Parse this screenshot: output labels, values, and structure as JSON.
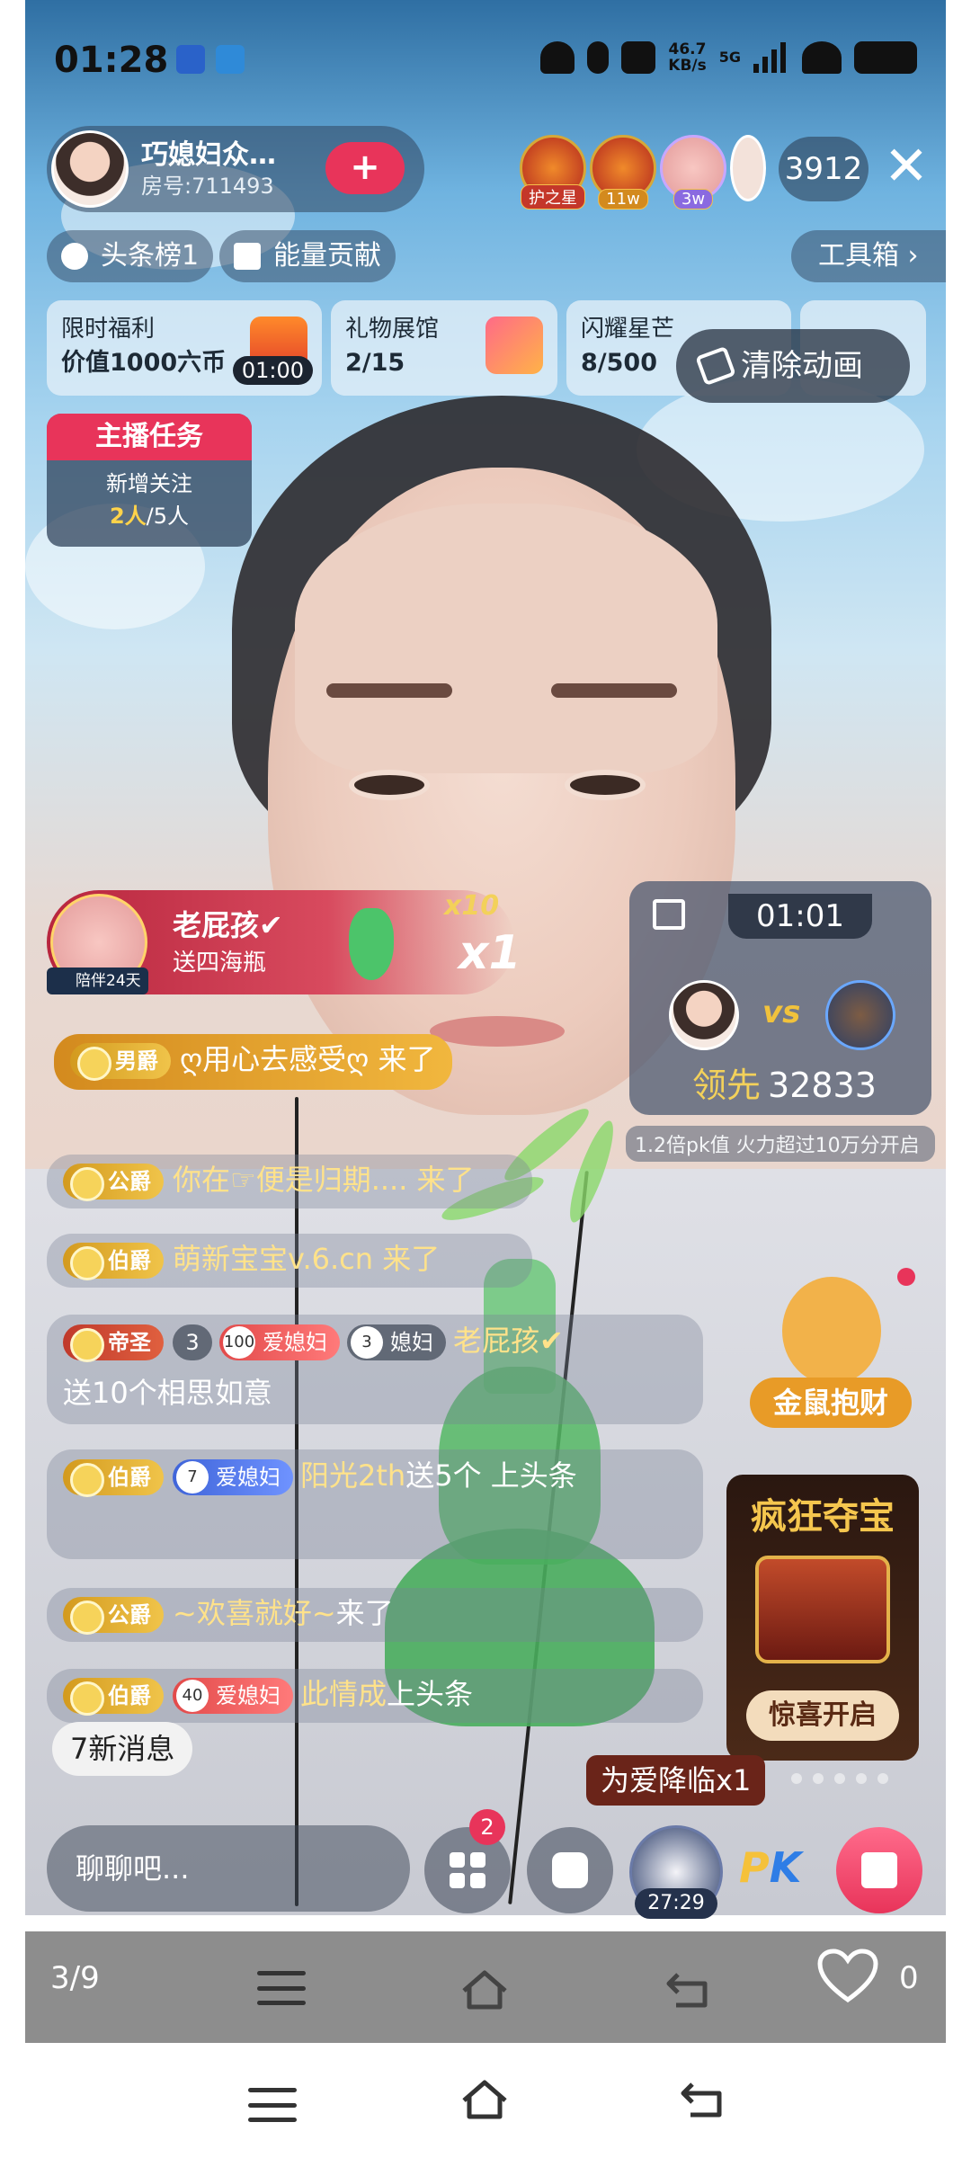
{
  "status_bar": {
    "time": "01:28",
    "net_speed_value": "46.7",
    "net_speed_unit": "KB/s",
    "network": "5G"
  },
  "host": {
    "name": "巧媳妇众…",
    "room": "房号:711493"
  },
  "viewers": {
    "badges": [
      "护之星",
      "11w",
      "3w"
    ],
    "count": "3912"
  },
  "pills": {
    "headline": "头条榜1",
    "energy": "能量贡献",
    "toolbox": "工具箱 ›"
  },
  "cards": [
    {
      "title": "限时福利",
      "value": "价值1000六币",
      "timer": "01:00"
    },
    {
      "title": "礼物展馆",
      "value": "2/15"
    },
    {
      "title": "闪耀星芒",
      "value": "8/500"
    }
  ],
  "clear_animation": "清除动画",
  "task": {
    "header": "主播任务",
    "line1": "新增关注",
    "progress_done": "2人",
    "progress_total": "/5人"
  },
  "gift_banner": {
    "user": "老屁孩✔",
    "text": "送四海瓶",
    "tag": "陪伴24天",
    "combo_small": "x10",
    "combo_big": "x1"
  },
  "pk": {
    "time": "01:01",
    "vs": "vs",
    "lead_label": "领先",
    "lead_value": "32833",
    "note": "1.2倍pk值    火力超过10万分开启"
  },
  "chat": [
    {
      "rank": "男爵",
      "user": "ღ用心去感受ღ",
      "msg": " 来了"
    },
    {
      "rank": "公爵",
      "user": "你在☞便是归期.... 来了",
      "msg": ""
    },
    {
      "rank": "伯爵",
      "user": "萌新宝宝v.6.cn 来了",
      "msg": ""
    },
    {
      "rank": "帝圣",
      "lvl": "3",
      "fan1": "100",
      "fan1_name": "爱媳妇",
      "fan2": "3",
      "fan2_name": "媳妇",
      "user": "老屁孩✔",
      "msg": "送10个相思如意"
    },
    {
      "rank": "伯爵",
      "fan1": "7",
      "fan1_name": "爱媳妇",
      "user": "阳光2th",
      "msg": "送5个 上头条"
    },
    {
      "rank": "公爵",
      "user": "~欢喜就好~",
      "msg": "来了"
    },
    {
      "rank": "伯爵",
      "fan1": "40",
      "fan1_name": "爱媳妇",
      "user": "此情成",
      "msg": "上头条"
    }
  ],
  "new_messages": "7新消息",
  "promo": {
    "mouse": "金鼠抱财",
    "treasure_title": "疯狂夺宝",
    "treasure_button": "惊喜开启"
  },
  "tip": "为爱降临x1",
  "bottom": {
    "input_placeholder": "聊聊吧...",
    "apps_badge": "2",
    "avatar_timer": "27:29",
    "pk_label_p": "P",
    "pk_label_k": "K"
  },
  "gray_bar": {
    "page_index": "3/9",
    "likes": "0"
  }
}
